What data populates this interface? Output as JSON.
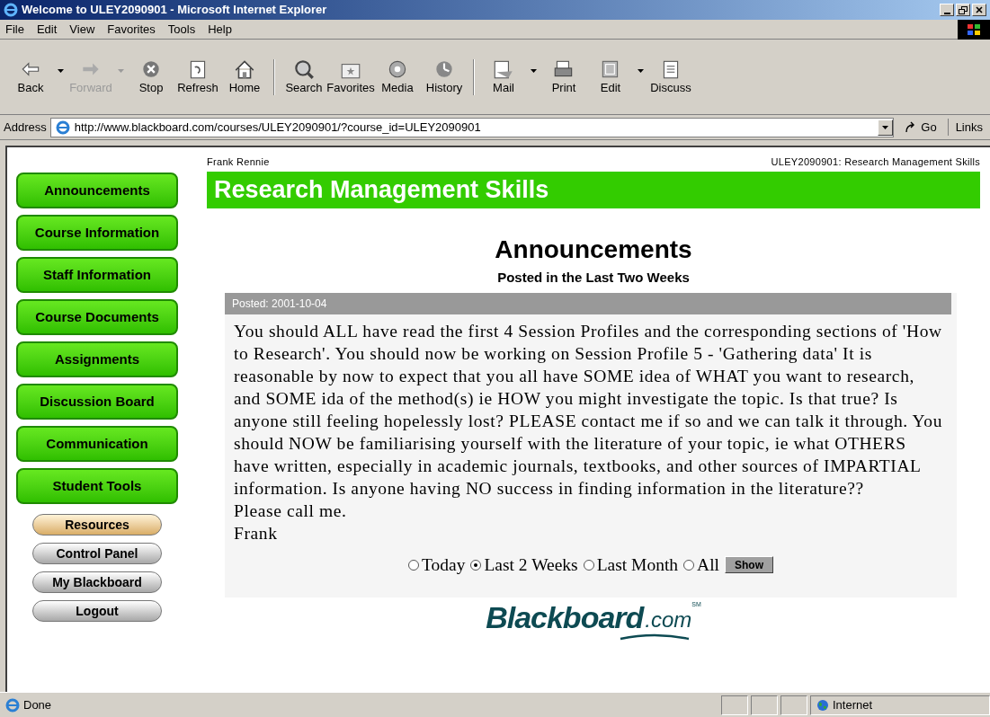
{
  "window": {
    "title": "Welcome to ULEY2090901 - Microsoft Internet Explorer"
  },
  "menu": [
    "File",
    "Edit",
    "View",
    "Favorites",
    "Tools",
    "Help"
  ],
  "toolbar": [
    {
      "label": "Back",
      "disabled": false,
      "dropdown": true
    },
    {
      "label": "Forward",
      "disabled": true,
      "dropdown": true
    },
    {
      "label": "Stop",
      "disabled": false,
      "dropdown": false
    },
    {
      "label": "Refresh",
      "disabled": false,
      "dropdown": false
    },
    {
      "label": "Home",
      "disabled": false,
      "dropdown": false
    },
    {
      "label": "Search",
      "disabled": false,
      "dropdown": false
    },
    {
      "label": "Favorites",
      "disabled": false,
      "dropdown": false
    },
    {
      "label": "Media",
      "disabled": false,
      "dropdown": false
    },
    {
      "label": "History",
      "disabled": false,
      "dropdown": false
    },
    {
      "label": "Mail",
      "disabled": false,
      "dropdown": true
    },
    {
      "label": "Print",
      "disabled": false,
      "dropdown": false
    },
    {
      "label": "Edit",
      "disabled": false,
      "dropdown": true
    },
    {
      "label": "Discuss",
      "disabled": false,
      "dropdown": false
    }
  ],
  "address_bar": {
    "label": "Address",
    "value": "http://www.blackboard.com/courses/ULEY2090901/?course_id=ULEY2090901",
    "go": "Go",
    "links": "Links"
  },
  "page": {
    "user": "Frank Rennie",
    "course_code": "ULEY2090901: Research Management Skills",
    "banner": "Research Management Skills",
    "nav": [
      "Announcements",
      "Course Information",
      "Staff Information",
      "Course Documents",
      "Assignments",
      "Discussion Board",
      "Communication",
      "Student Tools"
    ],
    "pills": [
      {
        "label": "Resources",
        "highlighted": true
      },
      {
        "label": "Control Panel",
        "highlighted": false
      },
      {
        "label": "My Blackboard",
        "highlighted": false
      },
      {
        "label": "Logout",
        "highlighted": false
      }
    ],
    "heading": "Announcements",
    "subheading": "Posted in the Last Two Weeks",
    "announcement": {
      "posted": "Posted: 2001-10-04",
      "paragraphs": [
        "You should ALL have read the first 4 Session Profiles and the corresponding sections of 'How to Research'. You should now be working on Session Profile 5 - 'Gathering data' It is reasonable by now to expect that you all have SOME idea of WHAT you want to research, and SOME ida of the method(s) ie HOW you might investigate the topic. Is that true? Is anyone still feeling hopelessly lost? PLEASE contact me if so and we can talk it through. You should NOW be familiarising yourself with the literature of your topic, ie what OTHERS have written, especially in academic journals, textbooks, and other sources of IMPARTIAL information. Is anyone having NO success in finding information in the literature??",
        "Please call me.",
        "Frank"
      ]
    },
    "filters": [
      {
        "label": "Today",
        "selected": false
      },
      {
        "label": "Last 2 Weeks",
        "selected": true
      },
      {
        "label": "Last Month",
        "selected": false
      },
      {
        "label": "All",
        "selected": false
      }
    ],
    "show_button": "Show",
    "logo": {
      "word": "Blackboard",
      "suffix": ".com",
      "mark": "SM"
    }
  },
  "status_bar": {
    "text": "Done",
    "zone": "Internet"
  }
}
